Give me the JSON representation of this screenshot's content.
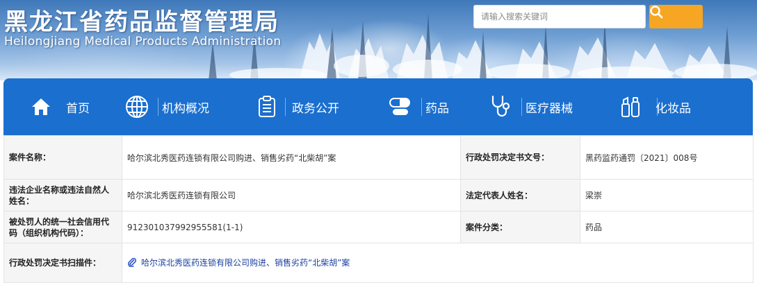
{
  "header": {
    "title_cn": "黑龙江省药品监督管理局",
    "title_en": "Heilongjiang Medical Products Administration"
  },
  "search": {
    "placeholder": "请输入搜索关键词",
    "value": "",
    "button_icon": "search-icon",
    "button_color": "#f6a623"
  },
  "nav": {
    "color": "#1a6fcf",
    "items": [
      {
        "label": "首页",
        "icon": "home-icon"
      },
      {
        "label": "机构概况",
        "icon": "globe-icon"
      },
      {
        "label": "政务公开",
        "icon": "clipboard-icon"
      },
      {
        "label": "药品",
        "icon": "pill-icon"
      },
      {
        "label": "医疗器械",
        "icon": "stethoscope-icon"
      },
      {
        "label": "化妆品",
        "icon": "cosmetics-icon"
      }
    ]
  },
  "case": {
    "rows": [
      {
        "k1": "案件名称：",
        "v1": "哈尔滨北秀医药连锁有限公司购进、销售劣药“北柴胡”案",
        "k2": "行政处罚决定书文号：",
        "v2": "黑药监药通罚〔2021〕008号"
      },
      {
        "k1": "违法企业名称或违法自然人姓名：",
        "v1": "哈尔滨北秀医药连锁有限公司",
        "k2": "法定代表人姓名：",
        "v2": "梁崇"
      },
      {
        "k1": "被处罚人的统一社会信用代码（组织机构代码）：",
        "v1": "912301037992955581(1-1)",
        "k2": "案件分类：",
        "v2": "药品"
      }
    ],
    "attachment": {
      "label": "行政处罚决定书扫描件：",
      "link_text": "哈尔滨北秀医药连锁有限公司购进、销售劣药“北柴胡”案",
      "icon": "paperclip-icon"
    }
  }
}
